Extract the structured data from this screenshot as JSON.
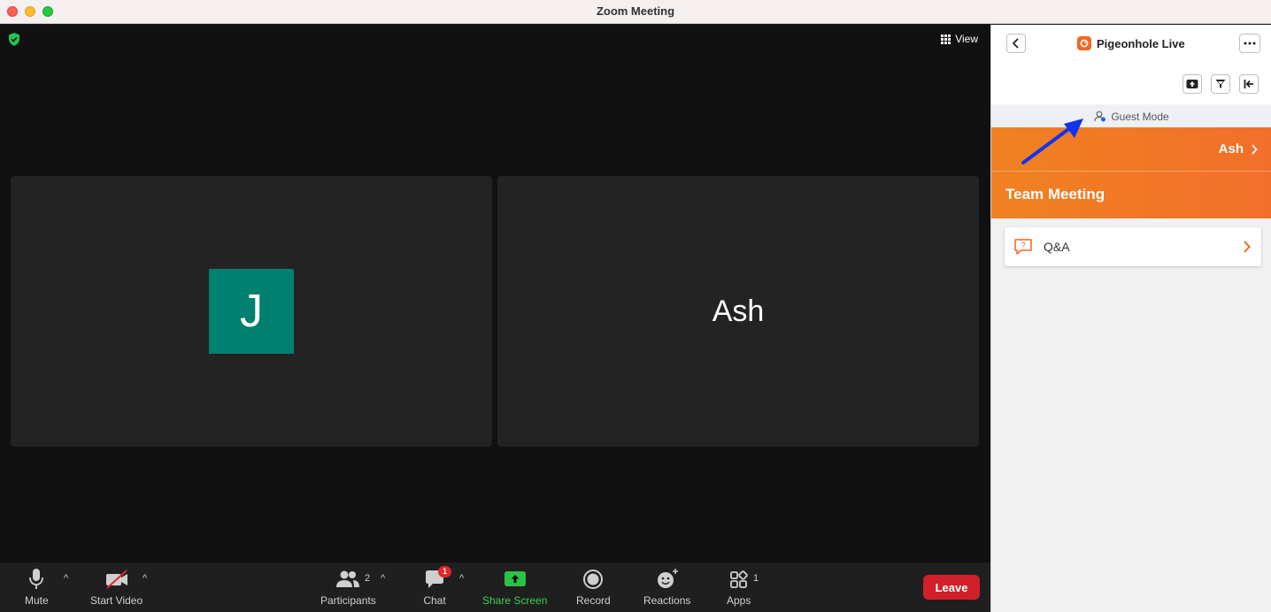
{
  "window": {
    "title": "Zoom Meeting"
  },
  "meeting": {
    "view_label": "View",
    "tiles": [
      {
        "type": "avatar",
        "initial": "J",
        "color": "#00806e"
      },
      {
        "type": "name",
        "name": "Ash"
      }
    ]
  },
  "toolbar": {
    "mute_label": "Mute",
    "video_label": "Start Video",
    "participants_label": "Participants",
    "participants_count": "2",
    "chat_label": "Chat",
    "chat_badge": "1",
    "share_label": "Share Screen",
    "record_label": "Record",
    "reactions_label": "Reactions",
    "apps_label": "Apps",
    "apps_count": "1",
    "leave_label": "Leave"
  },
  "panel": {
    "app_name": "Pigeonhole Live",
    "guest_mode_label": "Guest Mode",
    "user_name": "Ash",
    "event_title": "Team Meeting",
    "sessions": [
      {
        "label": "Q&A"
      }
    ],
    "brand_color": "#f26722"
  }
}
